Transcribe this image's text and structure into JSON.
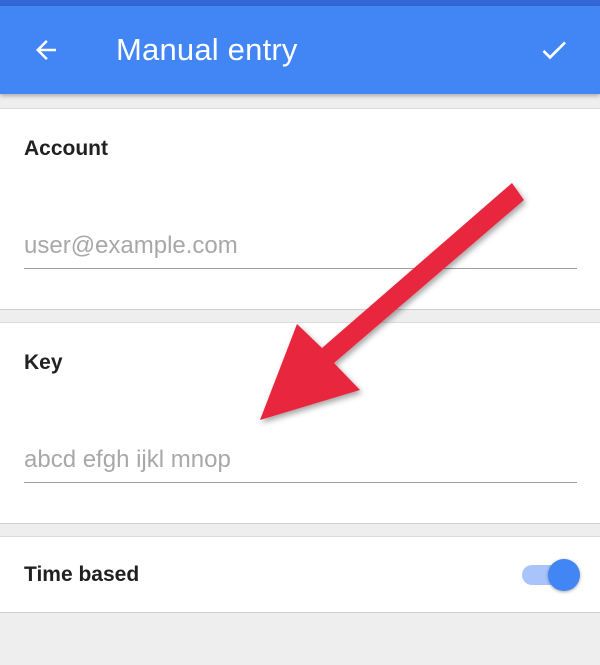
{
  "app_bar": {
    "title": "Manual entry",
    "color": "#4285f4",
    "back_icon": "arrow-back-icon",
    "confirm_icon": "check-icon"
  },
  "account": {
    "label": "Account",
    "value": "",
    "placeholder": "user@example.com"
  },
  "key": {
    "label": "Key",
    "value": "",
    "placeholder": "abcd efgh ijkl mnop"
  },
  "time_based": {
    "label": "Time based",
    "enabled": true
  },
  "annotation": {
    "icon": "red-arrow-icon",
    "color": "#e8283c"
  }
}
